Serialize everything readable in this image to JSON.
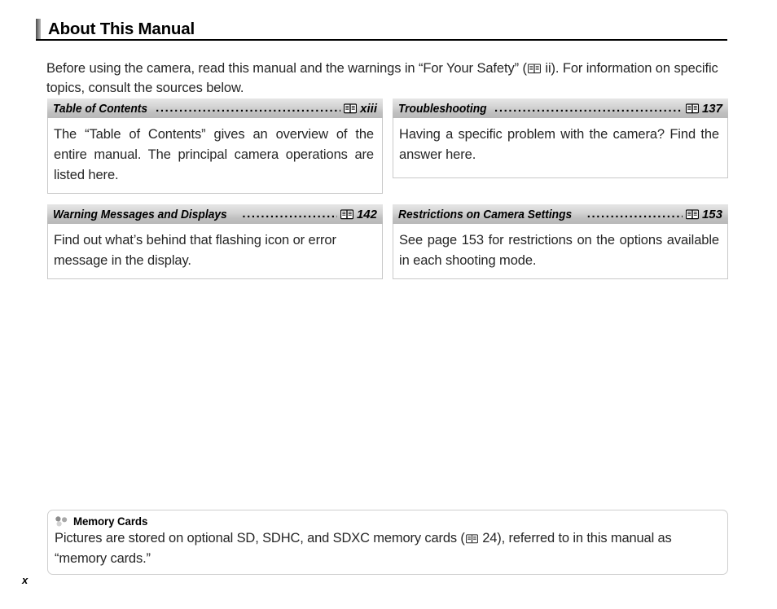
{
  "page": {
    "title": "About This Manual",
    "folio": "x"
  },
  "intro": {
    "text_before_icon": "Before using the camera, read this manual and the warnings in “For Your Safety” (",
    "icon": "book-icon",
    "text_after_icon": " ii).   For information on specific topics, consult the sources below."
  },
  "reference_boxes": [
    {
      "title": "Table of Contents",
      "leader": "................................................",
      "icon": "book-icon",
      "page": "xiii",
      "body": "The “Table of Contents” gives an overview of the entire manual.   The principal camera operations are listed here."
    },
    {
      "title": "Troubleshooting",
      "leader": "...............................................",
      "icon": "book-icon",
      "page": "137",
      "body": "Having a specific problem with the camera? Find the answer here."
    },
    {
      "title": "Warning Messages and Displays",
      "leader": "........................",
      "icon": "book-icon",
      "page": "142",
      "body": "Find out what’s behind that flashing icon or error message in the display."
    },
    {
      "title": "Restrictions on Camera Settings",
      "leader": "..........................",
      "icon": "book-icon",
      "page": "153",
      "body": "See page 153 for restrictions on the options available in each shooting mode."
    }
  ],
  "note": {
    "icon": "tip-dots-icon",
    "heading": "Memory Cards",
    "text_before_icon": "Pictures are stored on optional SD, SDHC, and SDXC memory cards (",
    "inline_icon": "book-icon",
    "text_after_icon": " 24), referred to in this manual as “memory cards.”"
  },
  "colors": {
    "header_gray_top": "#e6e6e6",
    "header_gray_bottom": "#b9b9b9",
    "box_border": "#c9c9c9",
    "text": "#262626",
    "rule": "#000000"
  }
}
